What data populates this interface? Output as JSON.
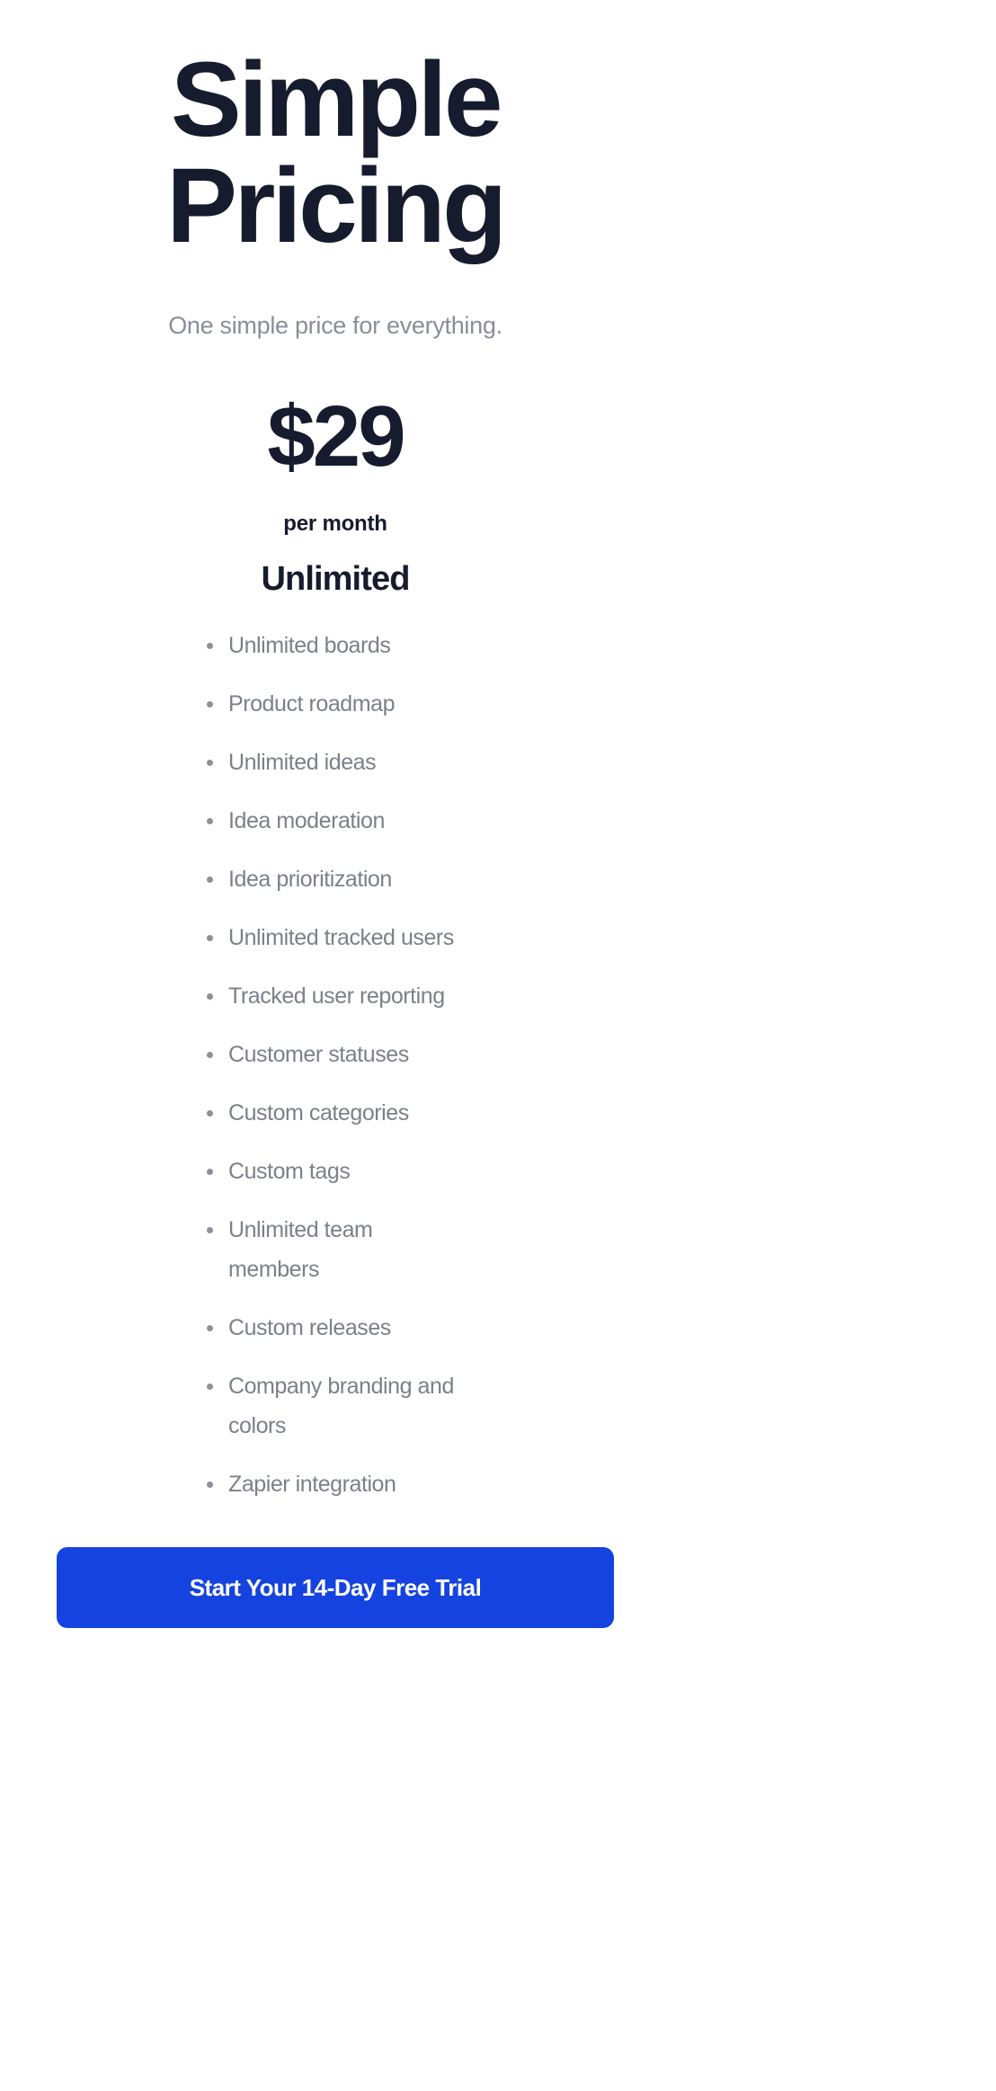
{
  "header": {
    "title": "Simple Pricing",
    "subtitle": "One simple price for everything."
  },
  "pricing": {
    "amount": "$29",
    "period": "per month",
    "plan_name": "Unlimited"
  },
  "features": [
    "Unlimited boards",
    "Product roadmap",
    "Unlimited ideas",
    "Idea moderation",
    "Idea prioritization",
    "Unlimited tracked users",
    "Tracked user reporting",
    "Customer statuses",
    "Custom categories",
    "Custom tags",
    "Unlimited team members",
    "Custom releases",
    "Company branding and colors",
    "Zapier integration"
  ],
  "cta": {
    "label": "Start Your 14-Day Free Trial"
  },
  "colors": {
    "heading": "#161b2e",
    "subtitle": "#8a8e99",
    "feature_text": "#7c8089",
    "bullet": "#8d9199",
    "cta_background": "#1543e0",
    "cta_text": "#ffffff",
    "page_background": "#ffffff"
  }
}
